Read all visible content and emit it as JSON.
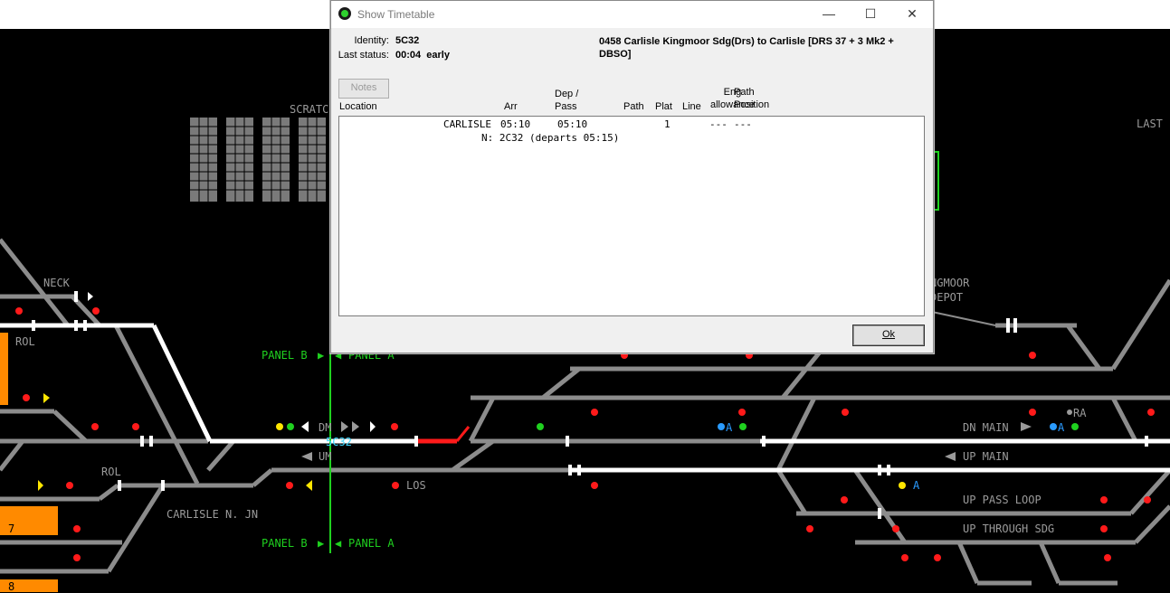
{
  "dialog": {
    "title": "Show Timetable",
    "identity_label": "Identity:",
    "identity_value": "5C32",
    "last_status_label": "Last status:",
    "last_status_value": "00:04  early",
    "description": "0458 Carlisle Kingmoor Sdg(Drs) to Carlisle [DRS 37 + 3 Mk2 + DBSO]",
    "notes_button": "Notes",
    "columns": {
      "location": "Location",
      "arr": "Arr",
      "dep_pass": "Dep /\nPass",
      "path": "Path",
      "plat": "Plat",
      "line": "Line",
      "eng_allowance": "Eng\nallowance",
      "path_position": "Path\nPosition"
    },
    "rows": [
      {
        "location": "CARLISLE",
        "arr": "05:10",
        "dep": "05:10",
        "plat": "1",
        "eng": "---",
        "path_pos": "---"
      }
    ],
    "next_line": "N: 2C32 (departs 05:15)",
    "ok_button": "Ok"
  },
  "panel": {
    "labels": {
      "scratch": "SCRATC",
      "last": "LAST",
      "neck": "NECK",
      "rol_top": "ROL",
      "rol_bottom": "ROL",
      "kingmoor": "NGMOOR",
      "depot": "DEPOT",
      "panel_b_top": "PANEL B",
      "panel_a_top": "PANEL A",
      "panel_b_bottom": "PANEL B",
      "panel_a_bottom": "PANEL A",
      "dm": "DM",
      "um": "UM",
      "los": "LOS",
      "carlisle_n_jn": "CARLISLE N. JN",
      "dn_main": "DN MAIN",
      "up_main": "UP MAIN",
      "up_pass_loop": "UP PASS LOOP",
      "up_through_sdg": "UP THROUGH SDG",
      "train_id": "5C32",
      "ra": "RA",
      "a1": "A",
      "a2": "A",
      "a3": "A",
      "plat7": "7",
      "plat8": "8"
    },
    "colors": {
      "track": "#8c8c8c",
      "route_white": "#ffffff",
      "occupied_red": "#ff1a1a",
      "panel_green": "#1fd11f",
      "train_cyan": "#39d6ff",
      "platform_orange": "#ff8a00",
      "signal_red": "#ff1a1a",
      "signal_yellow": "#ffe600",
      "signal_green": "#1fd11f",
      "signal_blue": "#2a9bff"
    }
  }
}
